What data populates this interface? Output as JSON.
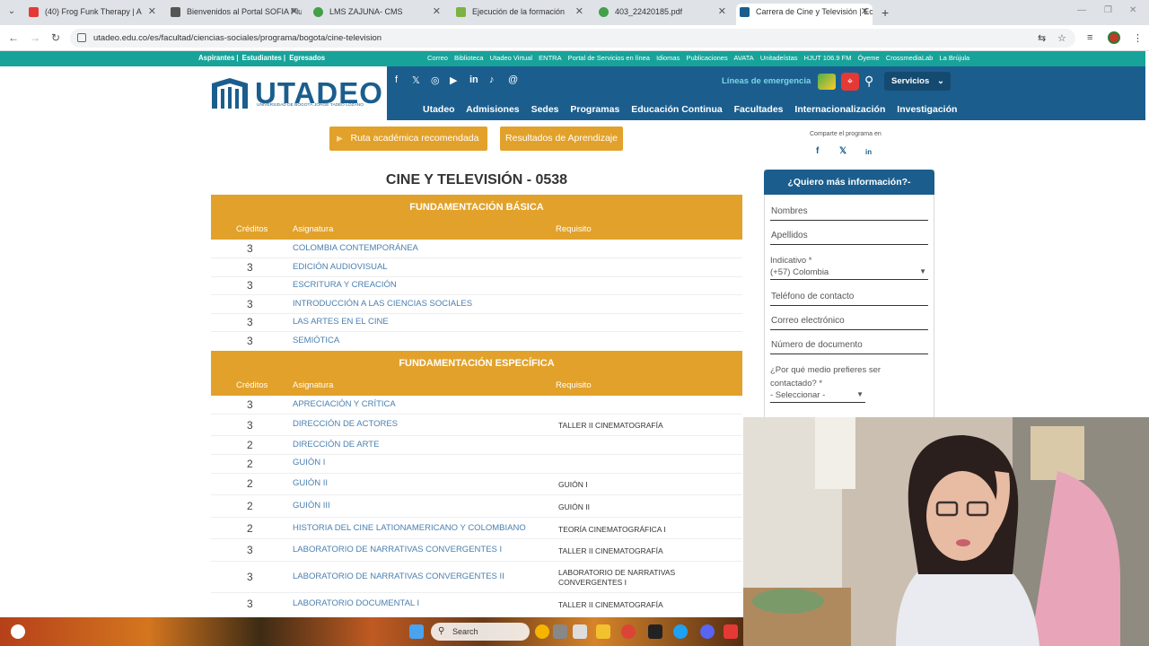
{
  "browser": {
    "tabs": [
      {
        "title": "(40) Frog Funk Therapy | A ",
        "color": "#e53935",
        "active": false
      },
      {
        "title": "Bienvenidos al Portal SOFIA Plu",
        "color": "#555555",
        "active": false
      },
      {
        "title": "LMS ZAJUNA- CMS",
        "color": "#43a047",
        "active": false
      },
      {
        "title": "Ejecución de la formación",
        "color": "#7cb342",
        "active": false
      },
      {
        "title": "403_22420185.pdf",
        "color": "#43a047",
        "active": false
      },
      {
        "title": "Carrera de Cine y Televisión | Ec",
        "color": "#1b5e8e",
        "active": true
      }
    ],
    "url": "utadeo.edu.co/es/facultad/ciencias-sociales/programa/bogota/cine-television"
  },
  "site": {
    "topstrip_left": [
      "Aspirantes",
      "Estudiantes",
      "Egresados"
    ],
    "topstrip_right": [
      "Correo",
      "Biblioteca",
      "Utadeo Virtual",
      "ENTRA",
      "Portal de Servicios en línea",
      "Idiomas",
      "Publicaciones",
      "AVATA",
      "Unitadeístas",
      "HJUT 106.9 FM",
      "Óyeme",
      "CrossmediaLab",
      "La Brújula"
    ],
    "logo_word": "UTADEO",
    "logo_sub": "UNIVERSIDAD DE BOGOTÁ JORGE TADEO LOZANO",
    "emergency": "Líneas de emergencia",
    "servicios": "Servicios",
    "nav": [
      "Utadeo",
      "Admisiones",
      "Sedes",
      "Programas",
      "Educación Continua",
      "Facultades",
      "Internacionalización",
      "Investigación"
    ]
  },
  "content": {
    "btn_ruta": "Ruta académica recomendada",
    "btn_resultados": "Resultados de Aprendizaje",
    "share_label": "Comparte el programa en",
    "title": "CINE Y TELEVISIÓN - 0538",
    "headers": {
      "creditos": "Créditos",
      "asignatura": "Asignatura",
      "requisito": "Requisito"
    },
    "sections": [
      {
        "title": "FUNDAMENTACIÓN BÁSICA",
        "rows": [
          {
            "cr": "3",
            "as": "COLOMBIA CONTEMPORÁNEA",
            "rq": ""
          },
          {
            "cr": "3",
            "as": "EDICIÓN AUDIOVISUAL",
            "rq": ""
          },
          {
            "cr": "3",
            "as": "ESCRITURA Y CREACIÓN",
            "rq": ""
          },
          {
            "cr": "3",
            "as": "INTRODUCCIÓN A LAS CIENCIAS SOCIALES",
            "rq": ""
          },
          {
            "cr": "3",
            "as": "LAS ARTES EN EL CINE",
            "rq": ""
          },
          {
            "cr": "3",
            "as": "SEMIÓTICA",
            "rq": ""
          }
        ]
      },
      {
        "title": "FUNDAMENTACIÓN ESPECÍFICA",
        "rows": [
          {
            "cr": "3",
            "as": "APRECIACIÓN Y CRÍTICA",
            "rq": ""
          },
          {
            "cr": "3",
            "as": "DIRECCIÓN DE ACTORES",
            "rq": "TALLER II CINEMATOGRAFÍA"
          },
          {
            "cr": "2",
            "as": "DIRECCIÓN DE ARTE",
            "rq": ""
          },
          {
            "cr": "2",
            "as": "GUIÓN I",
            "rq": ""
          },
          {
            "cr": "2",
            "as": "GUIÓN II",
            "rq": "GUIÓN I"
          },
          {
            "cr": "2",
            "as": "GUIÓN III",
            "rq": "GUIÓN II"
          },
          {
            "cr": "2",
            "as": "HISTORIA DEL CINE LATIONAMERICANO Y COLOMBIANO",
            "rq": "TEORÍA CINEMATOGRÁFICA I"
          },
          {
            "cr": "3",
            "as": "LABORATORIO DE NARRATIVAS CONVERGENTES I",
            "rq": "TALLER II CINEMATOGRAFÍA"
          },
          {
            "cr": "3",
            "as": "LABORATORIO DE NARRATIVAS CONVERGENTES II",
            "rq": "LABORATORIO DE NARRATIVAS CONVERGENTES I"
          },
          {
            "cr": "3",
            "as": "LABORATORIO DOCUMENTAL I",
            "rq": "TALLER II CINEMATOGRAFÍA"
          }
        ]
      }
    ]
  },
  "form": {
    "title": "¿Quiero más información?-",
    "nombres": "Nombres",
    "apellidos": "Apellidos",
    "indicativo_label": "Indicativo *",
    "indicativo_value": "(+57) Colombia",
    "telefono": "Teléfono de contacto",
    "correo": "Correo electrónico",
    "documento": "Número de documento",
    "medio_label": "¿Por qué medio prefieres ser contactado? *",
    "medio_value": "- Seleccionar -"
  },
  "taskbar": {
    "search": "Search"
  },
  "colors": {
    "brand_blue": "#1b5e8e",
    "teal": "#17a39a",
    "gold": "#e2a12a",
    "link": "#4a7fb0"
  }
}
